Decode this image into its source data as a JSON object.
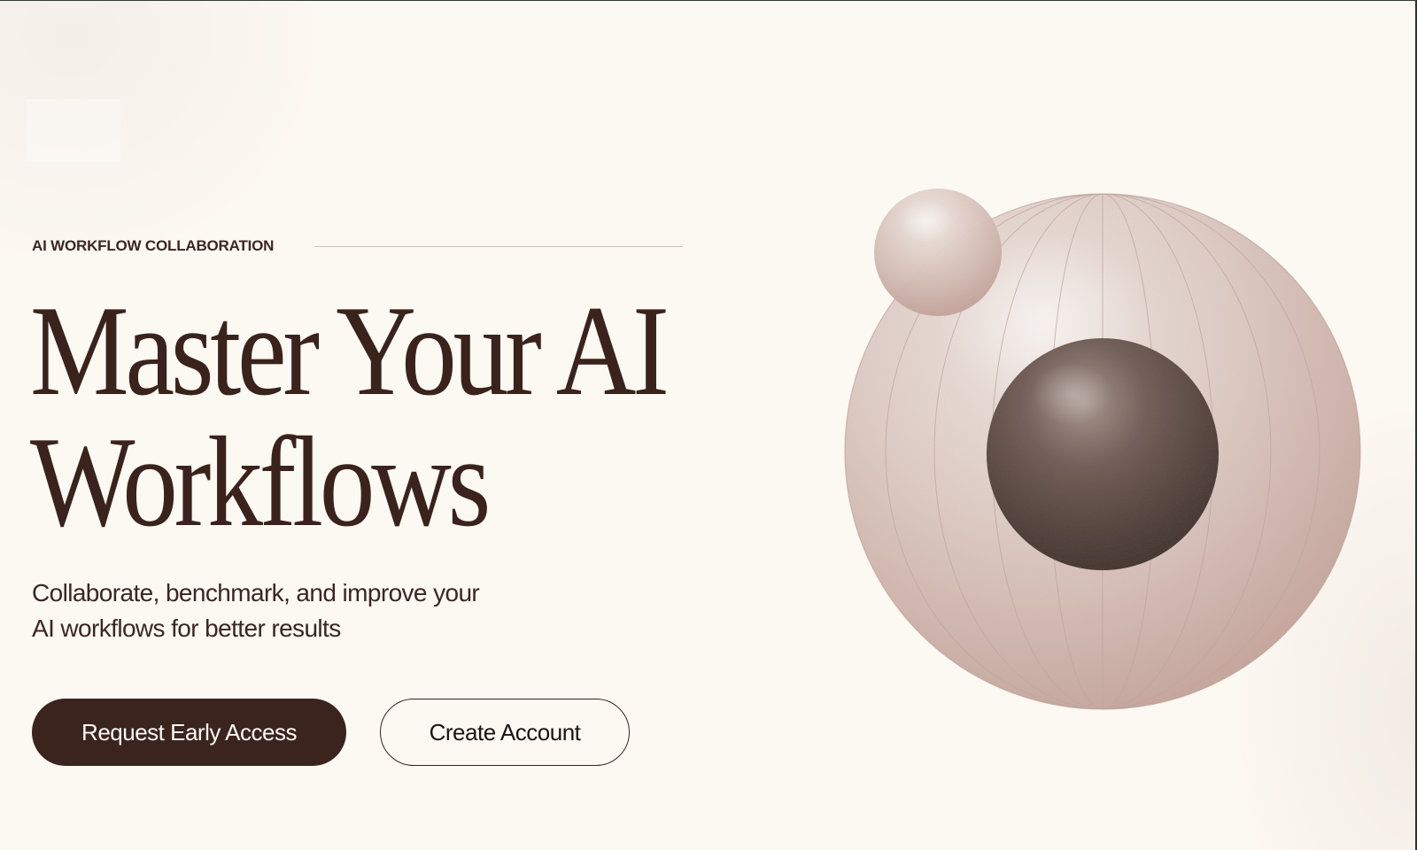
{
  "hero": {
    "eyebrow": "AI WORKFLOW COLLABORATION",
    "headline_line1": "Master Your AI",
    "headline_line2": "Workflows",
    "subtext_line1": "Collaborate, benchmark, and improve your",
    "subtext_line2": "AI workflows for better results"
  },
  "actions": {
    "primary_label": "Request Early Access",
    "secondary_label": "Create Account"
  },
  "illustration": {
    "name": "orbiting-spheres-graphic"
  },
  "colors": {
    "background": "#fcf8f2",
    "text_dark": "#3a231d",
    "primary_button": "#3b241e",
    "sphere_light": "#e8d9d3",
    "sphere_dark": "#3a2b27"
  }
}
